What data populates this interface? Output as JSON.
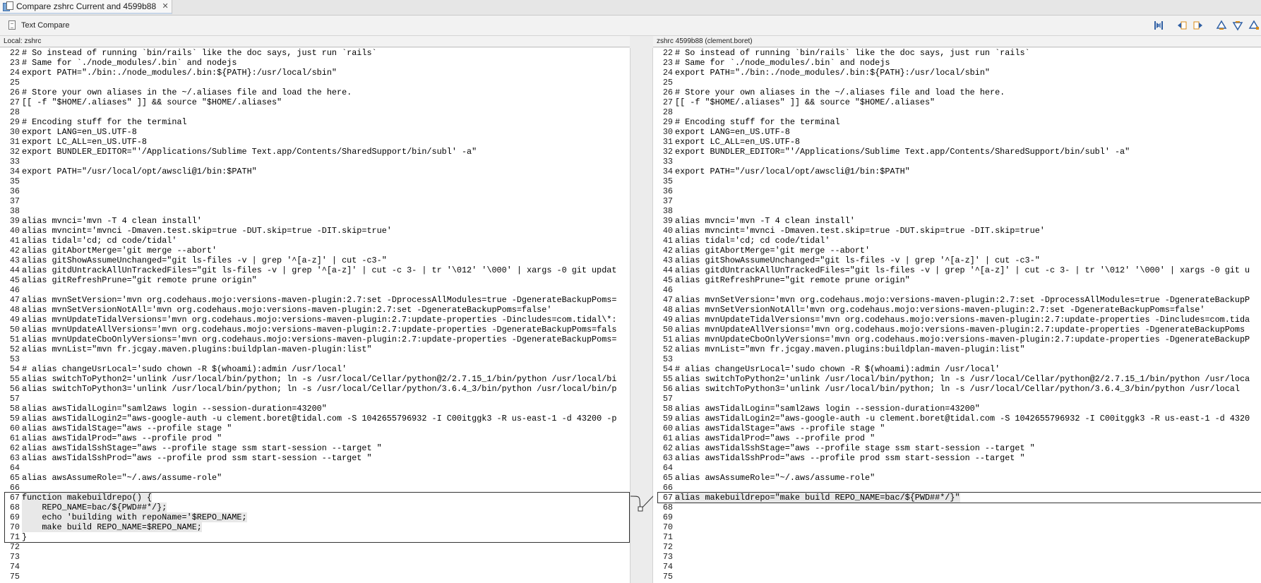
{
  "tab": {
    "title": "Compare zshrc Current and 4599b88",
    "close_icon": "close-icon"
  },
  "header": {
    "title": "Text Compare",
    "icon": "text-compare-icon"
  },
  "toolbar": {
    "buttons": [
      "two-way-compare-icon",
      "copy-all-to-left-icon",
      "copy-to-left-icon",
      "next-difference-icon",
      "previous-difference-icon",
      "next-change-icon"
    ]
  },
  "left_pane": {
    "title": "Local: zshrc",
    "lines": [
      {
        "n": "22",
        "t": "# So instead of running `bin/rails` like the doc says, just run `rails`"
      },
      {
        "n": "23",
        "t": "# Same for `./node_modules/.bin` and nodejs"
      },
      {
        "n": "24",
        "t": "export PATH=\"./bin:./node_modules/.bin:${PATH}:/usr/local/sbin\""
      },
      {
        "n": "25",
        "t": ""
      },
      {
        "n": "26",
        "t": "# Store your own aliases in the ~/.aliases file and load the here."
      },
      {
        "n": "27",
        "t": "[[ -f \"$HOME/.aliases\" ]] && source \"$HOME/.aliases\""
      },
      {
        "n": "28",
        "t": ""
      },
      {
        "n": "29",
        "t": "# Encoding stuff for the terminal"
      },
      {
        "n": "30",
        "t": "export LANG=en_US.UTF-8"
      },
      {
        "n": "31",
        "t": "export LC_ALL=en_US.UTF-8"
      },
      {
        "n": "32",
        "t": "export BUNDLER_EDITOR=\"'/Applications/Sublime Text.app/Contents/SharedSupport/bin/subl' -a\""
      },
      {
        "n": "33",
        "t": ""
      },
      {
        "n": "34",
        "t": "export PATH=\"/usr/local/opt/awscli@1/bin:$PATH\""
      },
      {
        "n": "35",
        "t": ""
      },
      {
        "n": "36",
        "t": ""
      },
      {
        "n": "37",
        "t": ""
      },
      {
        "n": "38",
        "t": ""
      },
      {
        "n": "39",
        "t": "alias mvnci='mvn -T 4 clean install'"
      },
      {
        "n": "40",
        "t": "alias mvncint='mvnci -Dmaven.test.skip=true -DUT.skip=true -DIT.skip=true'"
      },
      {
        "n": "41",
        "t": "alias tidal='cd; cd code/tidal'"
      },
      {
        "n": "42",
        "t": "alias gitAbortMerge='git merge --abort'"
      },
      {
        "n": "43",
        "t": "alias gitShowAssumeUnchanged=\"git ls-files -v | grep '^[a-z]' | cut -c3-\""
      },
      {
        "n": "44",
        "t": "alias gitdUntrackAllUnTrackedFiles=\"git ls-files -v | grep '^[a-z]' | cut -c 3- | tr '\\012' '\\000' | xargs -0 git updat"
      },
      {
        "n": "45",
        "t": "alias gitRefreshPrune=\"git remote prune origin\""
      },
      {
        "n": "46",
        "t": ""
      },
      {
        "n": "47",
        "t": "alias mvnSetVersion='mvn org.codehaus.mojo:versions-maven-plugin:2.7:set -DprocessAllModules=true -DgenerateBackupPoms="
      },
      {
        "n": "48",
        "t": "alias mvnSetVersionNotAll='mvn org.codehaus.mojo:versions-maven-plugin:2.7:set -DgenerateBackupPoms=false'"
      },
      {
        "n": "49",
        "t": "alias mvnUpdateTidalVersions='mvn org.codehaus.mojo:versions-maven-plugin:2.7:update-properties -Dincludes=com.tidal\\*:"
      },
      {
        "n": "50",
        "t": "alias mvnUpdateAllVersions='mvn org.codehaus.mojo:versions-maven-plugin:2.7:update-properties -DgenerateBackupPoms=fals"
      },
      {
        "n": "51",
        "t": "alias mvnUpdateCboOnlyVersions='mvn org.codehaus.mojo:versions-maven-plugin:2.7:update-properties -DgenerateBackupPoms="
      },
      {
        "n": "52",
        "t": "alias mvnList=\"mvn fr.jcgay.maven.plugins:buildplan-maven-plugin:list\""
      },
      {
        "n": "53",
        "t": ""
      },
      {
        "n": "54",
        "t": "# alias changeUsrLocal='sudo chown -R $(whoami):admin /usr/local'"
      },
      {
        "n": "55",
        "t": "alias switchToPython2='unlink /usr/local/bin/python; ln -s /usr/local/Cellar/python@2/2.7.15_1/bin/python /usr/local/bi"
      },
      {
        "n": "56",
        "t": "alias switchToPython3='unlink /usr/local/bin/python; ln -s /usr/local/Cellar/python/3.6.4_3/bin/python /usr/local/bin/p"
      },
      {
        "n": "57",
        "t": ""
      },
      {
        "n": "58",
        "t": "alias awsTidalLogin=\"saml2aws login --session-duration=43200\""
      },
      {
        "n": "59",
        "t": "alias awsTidalLogin2=\"aws-google-auth -u clement.boret@tidal.com -S 1042655796932 -I C00itggk3 -R us-east-1 -d 43200 -p"
      },
      {
        "n": "60",
        "t": "alias awsTidalStage=\"aws --profile stage \""
      },
      {
        "n": "61",
        "t": "alias awsTidalProd=\"aws --profile prod \""
      },
      {
        "n": "62",
        "t": "alias awsTidalSshStage=\"aws --profile stage ssm start-session --target \""
      },
      {
        "n": "63",
        "t": "alias awsTidalSshProd=\"aws --profile prod ssm start-session --target \""
      },
      {
        "n": "64",
        "t": ""
      },
      {
        "n": "65",
        "t": "alias awsAssumeRole=\"~/.aws/assume-role\""
      },
      {
        "n": "66",
        "t": ""
      },
      {
        "n": "67",
        "t": "function makebuildrepo() {",
        "chg": true
      },
      {
        "n": "68",
        "t": "    REPO_NAME=bac/${PWD##*/};",
        "chg": true
      },
      {
        "n": "69",
        "t": "    echo 'building with repoName='$REPO_NAME;",
        "chg": true
      },
      {
        "n": "70",
        "t": "    make build REPO_NAME=$REPO_NAME;",
        "chg": true
      },
      {
        "n": "71",
        "t": "}"
      },
      {
        "n": "72",
        "t": ""
      },
      {
        "n": "73",
        "t": ""
      },
      {
        "n": "74",
        "t": ""
      },
      {
        "n": "75",
        "t": ""
      }
    ]
  },
  "right_pane": {
    "title": "zshrc 4599b88 (clement.boret)",
    "lines": [
      {
        "n": "22",
        "t": "# So instead of running `bin/rails` like the doc says, just run `rails`"
      },
      {
        "n": "23",
        "t": "# Same for `./node_modules/.bin` and nodejs"
      },
      {
        "n": "24",
        "t": "export PATH=\"./bin:./node_modules/.bin:${PATH}:/usr/local/sbin\""
      },
      {
        "n": "25",
        "t": ""
      },
      {
        "n": "26",
        "t": "# Store your own aliases in the ~/.aliases file and load the here."
      },
      {
        "n": "27",
        "t": "[[ -f \"$HOME/.aliases\" ]] && source \"$HOME/.aliases\""
      },
      {
        "n": "28",
        "t": ""
      },
      {
        "n": "29",
        "t": "# Encoding stuff for the terminal"
      },
      {
        "n": "30",
        "t": "export LANG=en_US.UTF-8"
      },
      {
        "n": "31",
        "t": "export LC_ALL=en_US.UTF-8"
      },
      {
        "n": "32",
        "t": "export BUNDLER_EDITOR=\"'/Applications/Sublime Text.app/Contents/SharedSupport/bin/subl' -a\""
      },
      {
        "n": "33",
        "t": ""
      },
      {
        "n": "34",
        "t": "export PATH=\"/usr/local/opt/awscli@1/bin:$PATH\""
      },
      {
        "n": "35",
        "t": ""
      },
      {
        "n": "36",
        "t": ""
      },
      {
        "n": "37",
        "t": ""
      },
      {
        "n": "38",
        "t": ""
      },
      {
        "n": "39",
        "t": "alias mvnci='mvn -T 4 clean install'"
      },
      {
        "n": "40",
        "t": "alias mvncint='mvnci -Dmaven.test.skip=true -DUT.skip=true -DIT.skip=true'"
      },
      {
        "n": "41",
        "t": "alias tidal='cd; cd code/tidal'"
      },
      {
        "n": "42",
        "t": "alias gitAbortMerge='git merge --abort'"
      },
      {
        "n": "43",
        "t": "alias gitShowAssumeUnchanged=\"git ls-files -v | grep '^[a-z]' | cut -c3-\""
      },
      {
        "n": "44",
        "t": "alias gitdUntrackAllUnTrackedFiles=\"git ls-files -v | grep '^[a-z]' | cut -c 3- | tr '\\012' '\\000' | xargs -0 git u"
      },
      {
        "n": "45",
        "t": "alias gitRefreshPrune=\"git remote prune origin\""
      },
      {
        "n": "46",
        "t": ""
      },
      {
        "n": "47",
        "t": "alias mvnSetVersion='mvn org.codehaus.mojo:versions-maven-plugin:2.7:set -DprocessAllModules=true -DgenerateBackupP"
      },
      {
        "n": "48",
        "t": "alias mvnSetVersionNotAll='mvn org.codehaus.mojo:versions-maven-plugin:2.7:set -DgenerateBackupPoms=false'"
      },
      {
        "n": "49",
        "t": "alias mvnUpdateTidalVersions='mvn org.codehaus.mojo:versions-maven-plugin:2.7:update-properties -Dincludes=com.tida"
      },
      {
        "n": "50",
        "t": "alias mvnUpdateAllVersions='mvn org.codehaus.mojo:versions-maven-plugin:2.7:update-properties -DgenerateBackupPoms"
      },
      {
        "n": "51",
        "t": "alias mvnUpdateCboOnlyVersions='mvn org.codehaus.mojo:versions-maven-plugin:2.7:update-properties -DgenerateBackupP"
      },
      {
        "n": "52",
        "t": "alias mvnList=\"mvn fr.jcgay.maven.plugins:buildplan-maven-plugin:list\""
      },
      {
        "n": "53",
        "t": ""
      },
      {
        "n": "54",
        "t": "# alias changeUsrLocal='sudo chown -R $(whoami):admin /usr/local'"
      },
      {
        "n": "55",
        "t": "alias switchToPython2='unlink /usr/local/bin/python; ln -s /usr/local/Cellar/python@2/2.7.15_1/bin/python /usr/loca"
      },
      {
        "n": "56",
        "t": "alias switchToPython3='unlink /usr/local/bin/python; ln -s /usr/local/Cellar/python/3.6.4_3/bin/python /usr/local"
      },
      {
        "n": "57",
        "t": ""
      },
      {
        "n": "58",
        "t": "alias awsTidalLogin=\"saml2aws login --session-duration=43200\""
      },
      {
        "n": "59",
        "t": "alias awsTidalLogin2=\"aws-google-auth -u clement.boret@tidal.com -S 1042655796932 -I C00itggk3 -R us-east-1 -d 4320"
      },
      {
        "n": "60",
        "t": "alias awsTidalStage=\"aws --profile stage \""
      },
      {
        "n": "61",
        "t": "alias awsTidalProd=\"aws --profile prod \""
      },
      {
        "n": "62",
        "t": "alias awsTidalSshStage=\"aws --profile stage ssm start-session --target \""
      },
      {
        "n": "63",
        "t": "alias awsTidalSshProd=\"aws --profile prod ssm start-session --target \""
      },
      {
        "n": "64",
        "t": ""
      },
      {
        "n": "65",
        "t": "alias awsAssumeRole=\"~/.aws/assume-role\""
      },
      {
        "n": "66",
        "t": ""
      },
      {
        "n": "67",
        "t": "alias makebuildrepo=\"make build REPO_NAME=bac/${PWD##*/}\"",
        "chg": true
      },
      {
        "n": "68",
        "t": ""
      },
      {
        "n": "69",
        "t": ""
      },
      {
        "n": "70",
        "t": ""
      },
      {
        "n": "71",
        "t": ""
      },
      {
        "n": "72",
        "t": ""
      },
      {
        "n": "73",
        "t": ""
      },
      {
        "n": "74",
        "t": ""
      },
      {
        "n": "75",
        "t": ""
      }
    ]
  }
}
